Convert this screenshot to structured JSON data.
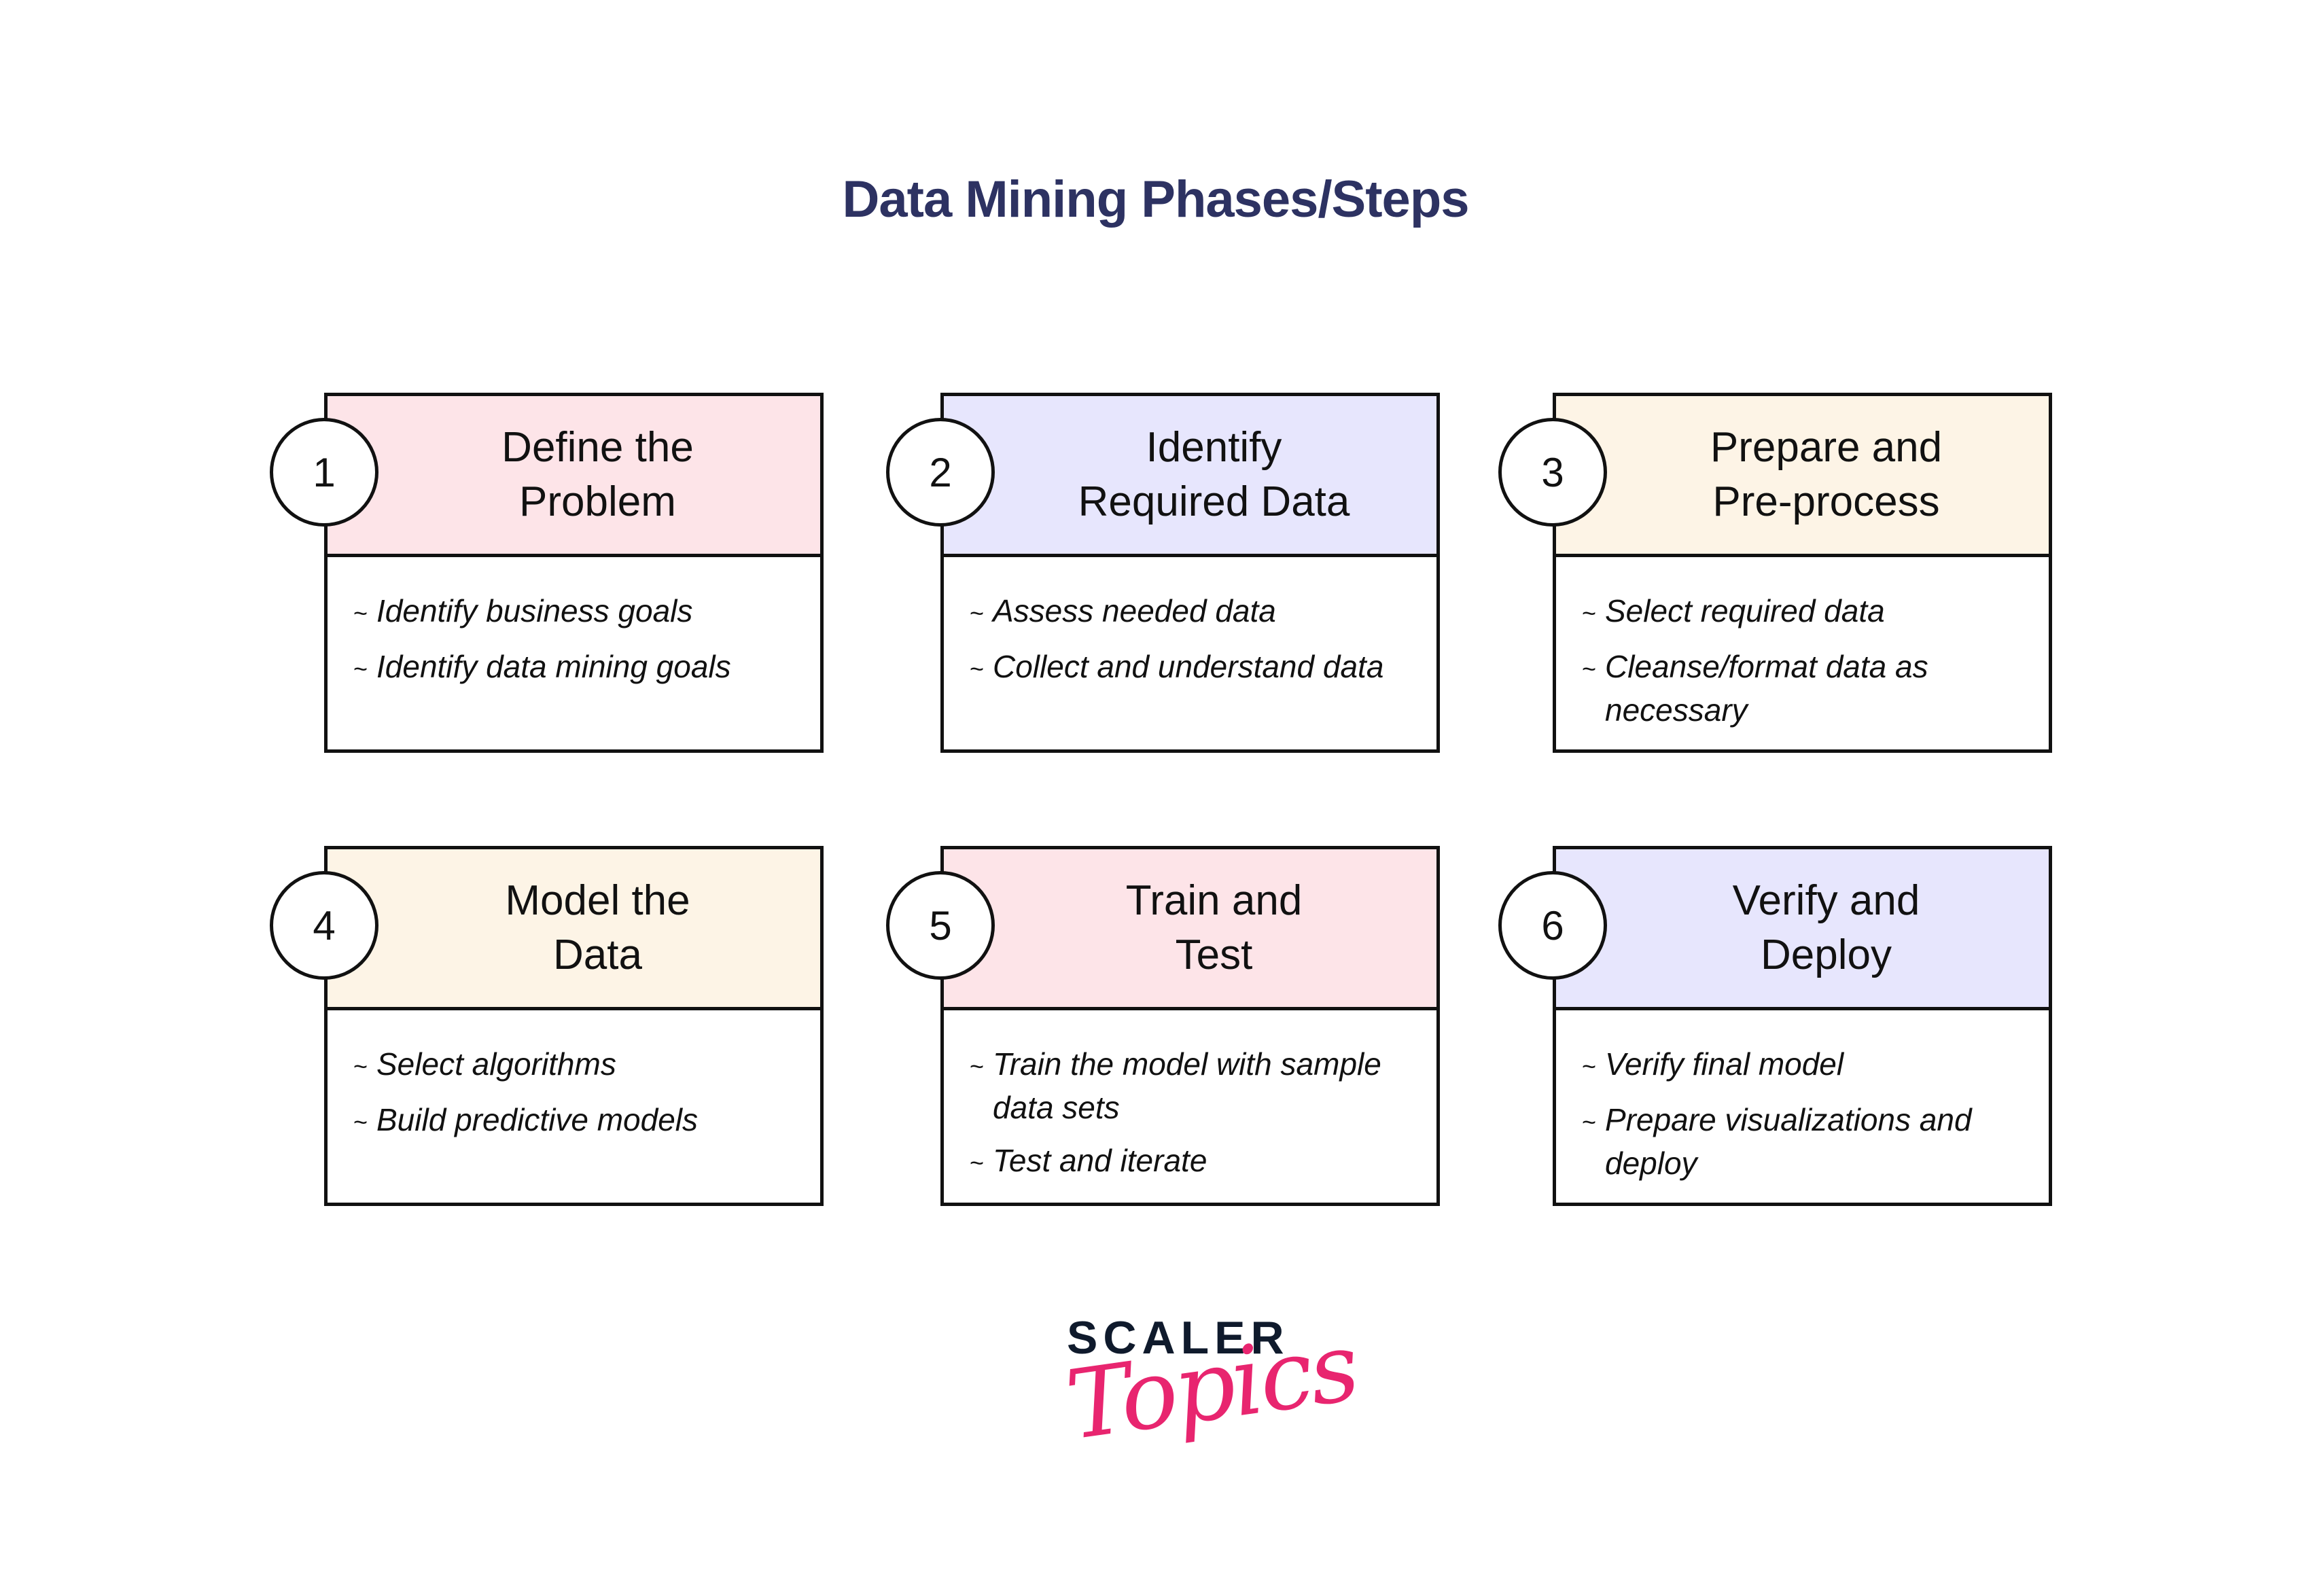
{
  "title": "Data Mining Phases/Steps",
  "colors": {
    "title": "#2d3262",
    "pink": "#fde4e8",
    "lavender": "#e7e6fd",
    "cream": "#fdf4e6",
    "logo_dark": "#0f1a2c",
    "logo_pink": "#e8256f"
  },
  "steps": [
    {
      "number": "1",
      "heading": "Define the\nProblem",
      "color": "pink",
      "bullets": [
        "Identify business goals",
        "Identify data mining goals"
      ]
    },
    {
      "number": "2",
      "heading": "Identify\nRequired Data",
      "color": "lavender",
      "bullets": [
        "Assess needed data",
        "Collect and understand data"
      ]
    },
    {
      "number": "3",
      "heading": "Prepare and\nPre-process",
      "color": "cream",
      "bullets": [
        "Select required data",
        "Cleanse/format data as necessary"
      ]
    },
    {
      "number": "4",
      "heading": "Model the\nData",
      "color": "cream",
      "bullets": [
        "Select algorithms",
        "Build predictive models"
      ]
    },
    {
      "number": "5",
      "heading": "Train and\nTest",
      "color": "pink",
      "bullets": [
        "Train the model with sample data sets",
        "Test and iterate"
      ]
    },
    {
      "number": "6",
      "heading": "Verify and\nDeploy",
      "color": "lavender",
      "bullets": [
        "Verify final model",
        "Prepare visualizations and deploy"
      ]
    }
  ],
  "bullet_marker": "~",
  "logo": {
    "top": "SCALER",
    "bottom": "Topics"
  }
}
